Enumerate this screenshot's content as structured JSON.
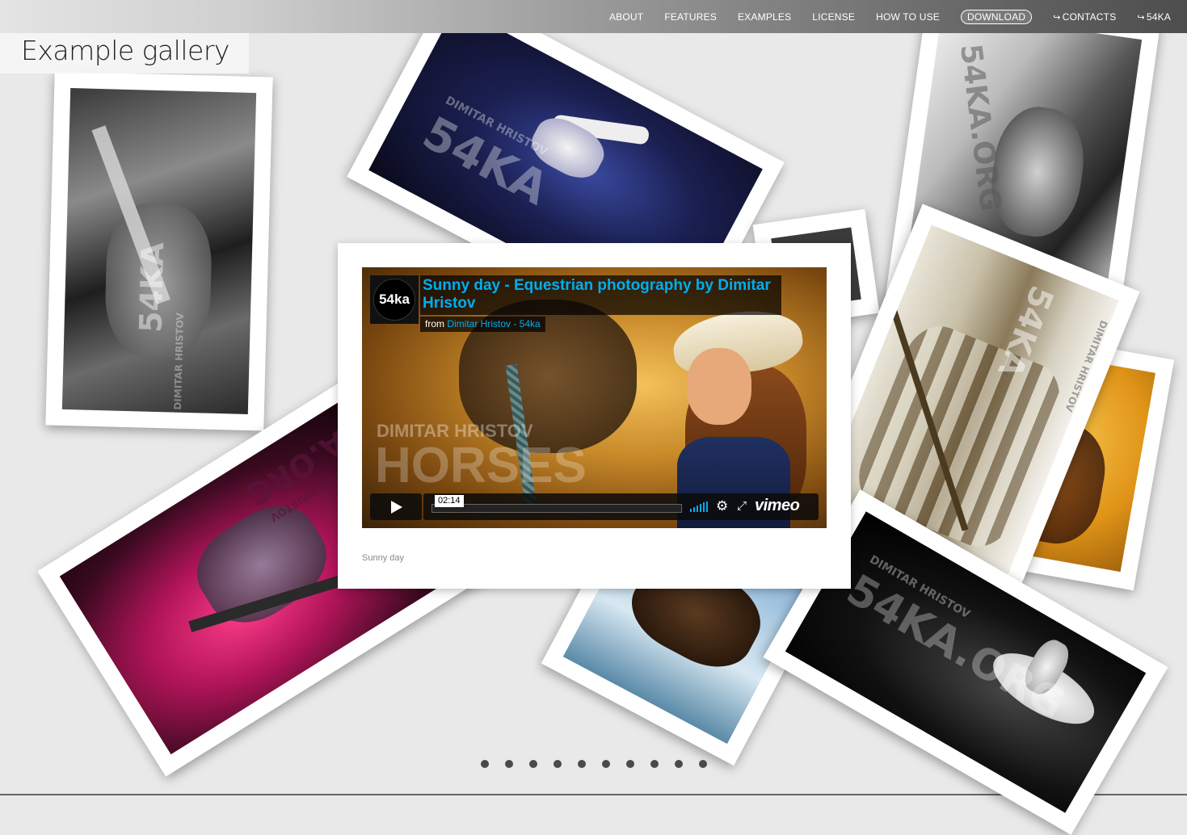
{
  "nav": {
    "items": [
      "ABOUT",
      "FEATURES",
      "EXAMPLES",
      "LICENSE",
      "HOW TO USE",
      "DOWNLOAD"
    ],
    "contacts": "CONTACTS",
    "brand": "54KA"
  },
  "page": {
    "title": "Example gallery"
  },
  "photos": {
    "wm_name": "DIMITAR HRISTOV",
    "wm_brand": "54KA",
    "wm_brand_org": "54KA.ORG",
    "wm_url": "www.54ka.org"
  },
  "video": {
    "logo": "54ka",
    "title": "Sunny day - Equestrian photography by Dimitar Hristov",
    "from_prefix": "from",
    "from_link": "Dimitar Hristov - 54ka",
    "time": "02:14",
    "brand": "vimeo",
    "wm_name": "DIMITAR HRISTOV",
    "wm_word": "HORSES"
  },
  "caption": "Sunny day",
  "pagination": {
    "count": 10
  },
  "colors": {
    "accent": "#00adef",
    "background": "#e9e9e9"
  }
}
